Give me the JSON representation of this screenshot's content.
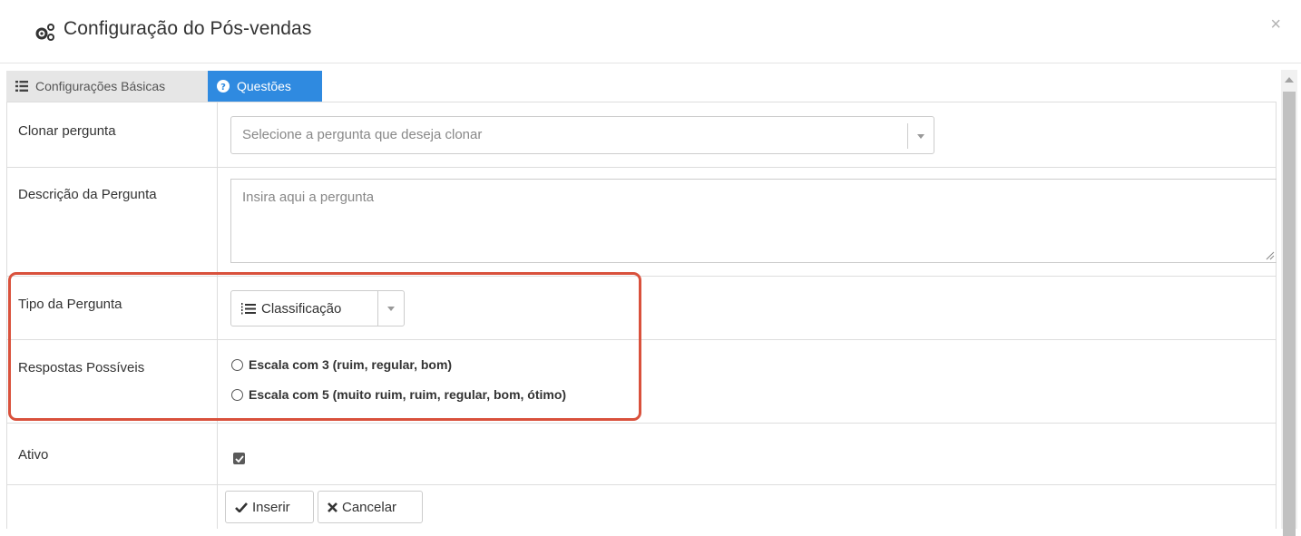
{
  "header": {
    "title": "Configuração do Pós-vendas",
    "close_label": "×"
  },
  "tabs": [
    {
      "label": "Configurações Básicas",
      "icon": "list-icon",
      "active": false
    },
    {
      "label": "Questões",
      "icon": "question-circle-icon",
      "active": true
    }
  ],
  "form": {
    "clone": {
      "label": "Clonar pergunta",
      "placeholder": "Selecione a pergunta que deseja clonar"
    },
    "description": {
      "label": "Descrição da Pergunta",
      "placeholder": "Insira aqui a pergunta"
    },
    "type": {
      "label": "Tipo da Pergunta",
      "selected": "Classificação"
    },
    "answers": {
      "label": "Respostas Possíveis",
      "options": [
        "Escala com 3 (ruim, regular, bom)",
        "Escala com 5 (muito ruim, ruim, regular, bom, ótimo)"
      ]
    },
    "active": {
      "label": "Ativo",
      "checked": true
    },
    "buttons": {
      "insert": "Inserir",
      "cancel": "Cancelar"
    }
  },
  "colors": {
    "active_tab": "#2f8ae0",
    "highlight": "#d9513c"
  }
}
